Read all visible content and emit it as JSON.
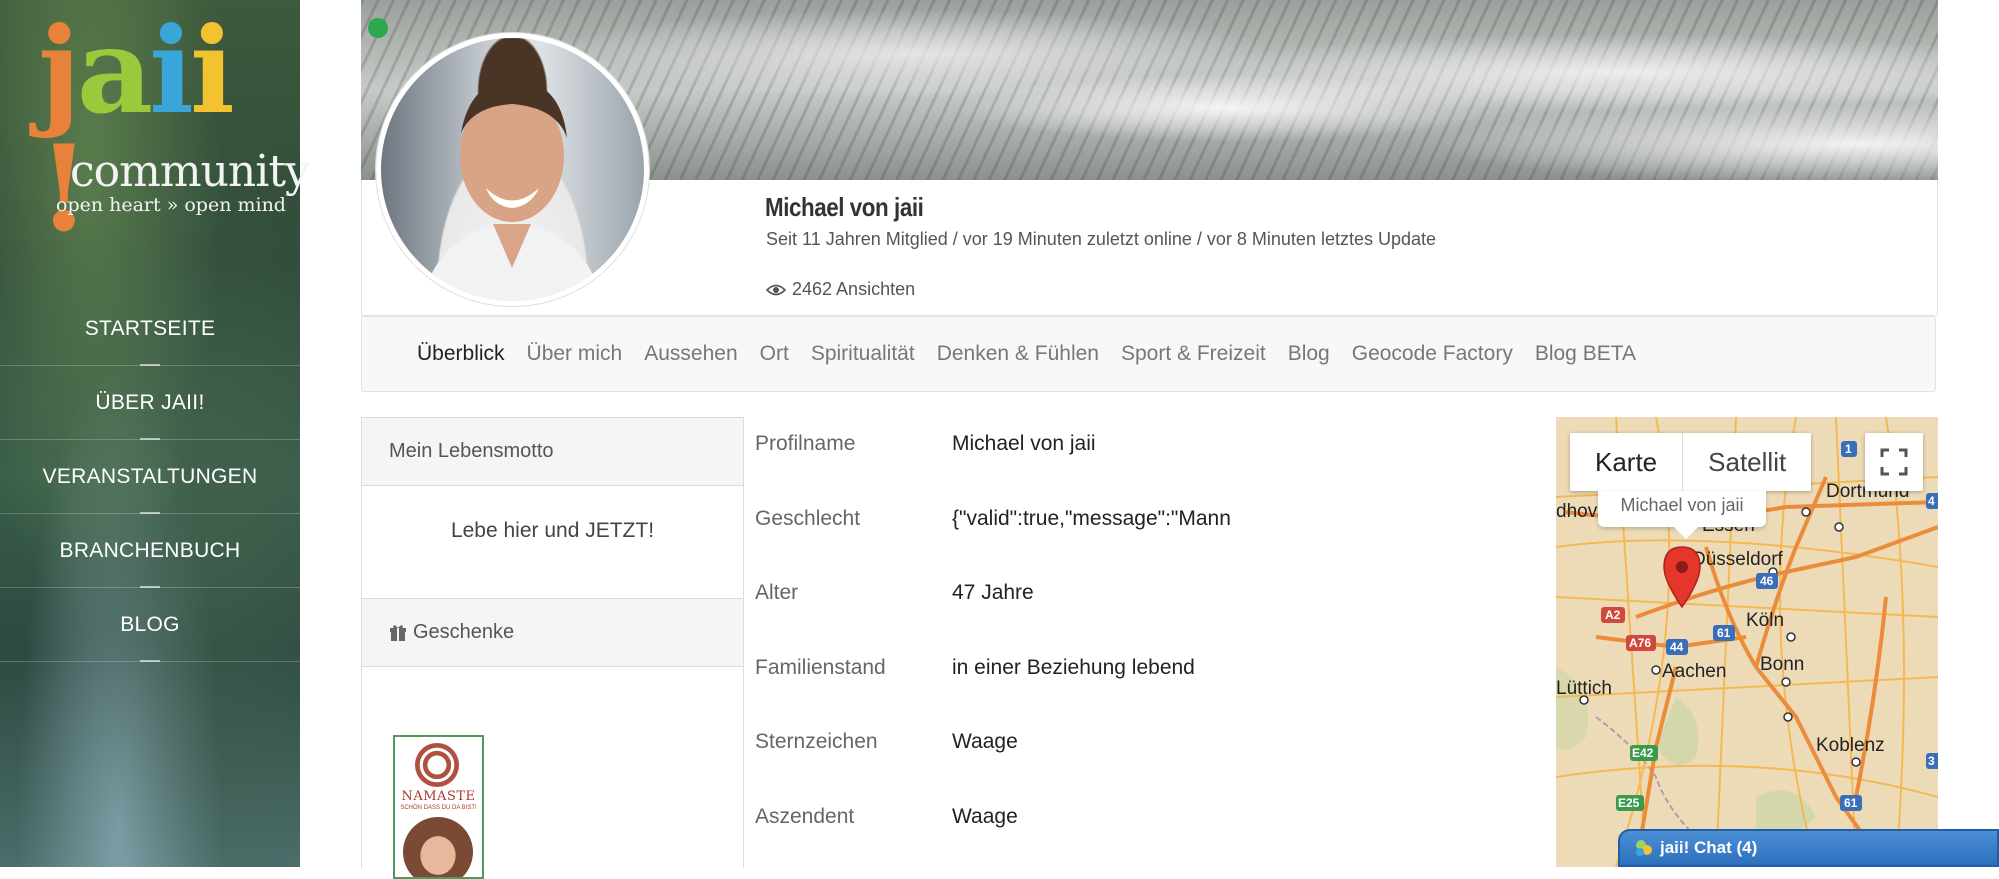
{
  "brand": {
    "logo_main": "jaii!",
    "logo_sub": "community",
    "logo_tagline": "open heart » open mind",
    "logo_colors": [
      "#e8823a",
      "#9cc83c",
      "#3aa5d8",
      "#f2c230",
      "#e8823a"
    ]
  },
  "nav": {
    "items": [
      {
        "label": "STARTSEITE"
      },
      {
        "label": "ÜBER JAII!"
      },
      {
        "label": "VERANSTALTUNGEN"
      },
      {
        "label": "BRANCHENBUCH"
      },
      {
        "label": "BLOG"
      }
    ]
  },
  "profile": {
    "name": "Michael von jaii",
    "meta": "Seit 11 Jahren Mitglied /  vor 19 Minuten zuletzt online /  vor 8 Minuten letztes Update",
    "views": "2462 Ansichten",
    "online_color": "#2ea84c"
  },
  "tabs": [
    {
      "label": "Überblick",
      "active": true
    },
    {
      "label": "Über mich"
    },
    {
      "label": "Aussehen"
    },
    {
      "label": "Ort"
    },
    {
      "label": "Spiritualität"
    },
    {
      "label": "Denken & Fühlen"
    },
    {
      "label": "Sport & Freizeit"
    },
    {
      "label": "Blog"
    },
    {
      "label": "Geocode Factory"
    },
    {
      "label": "Blog BETA"
    }
  ],
  "motto": {
    "heading": "Mein Lebensmotto",
    "text": "Lebe hier und JETZT!"
  },
  "gifts": {
    "heading": "Geschenke",
    "card_title": "NAMASTE",
    "card_subtitle": "SCHÖN DASS DU DA BIST!"
  },
  "details": [
    {
      "label": "Profilname",
      "value": "Michael von jaii"
    },
    {
      "label": "Geschlecht",
      "value": "{\"valid\":true,\"message\":\"Mann"
    },
    {
      "label": "Alter",
      "value": "47 Jahre"
    },
    {
      "label": "Familienstand",
      "value": "in einer Beziehung lebend"
    },
    {
      "label": "Sternzeichen",
      "value": "Waage"
    },
    {
      "label": "Aszendent",
      "value": "Waage"
    }
  ],
  "map": {
    "type_map": "Karte",
    "type_satellite": "Satellit",
    "info_label": "Michael von jaii",
    "cities": [
      "Dortmund",
      "Essen",
      "Düsseldorf",
      "Köln",
      "Bonn",
      "Aachen",
      "Lüttich",
      "Koblenz"
    ],
    "road_labels": [
      "A2",
      "A76",
      "44",
      "61",
      "46",
      "E42",
      "E25",
      "61",
      "4",
      "3",
      "1"
    ],
    "partial_label": "dhove"
  },
  "chat": {
    "label": "jaii! Chat (4)"
  }
}
